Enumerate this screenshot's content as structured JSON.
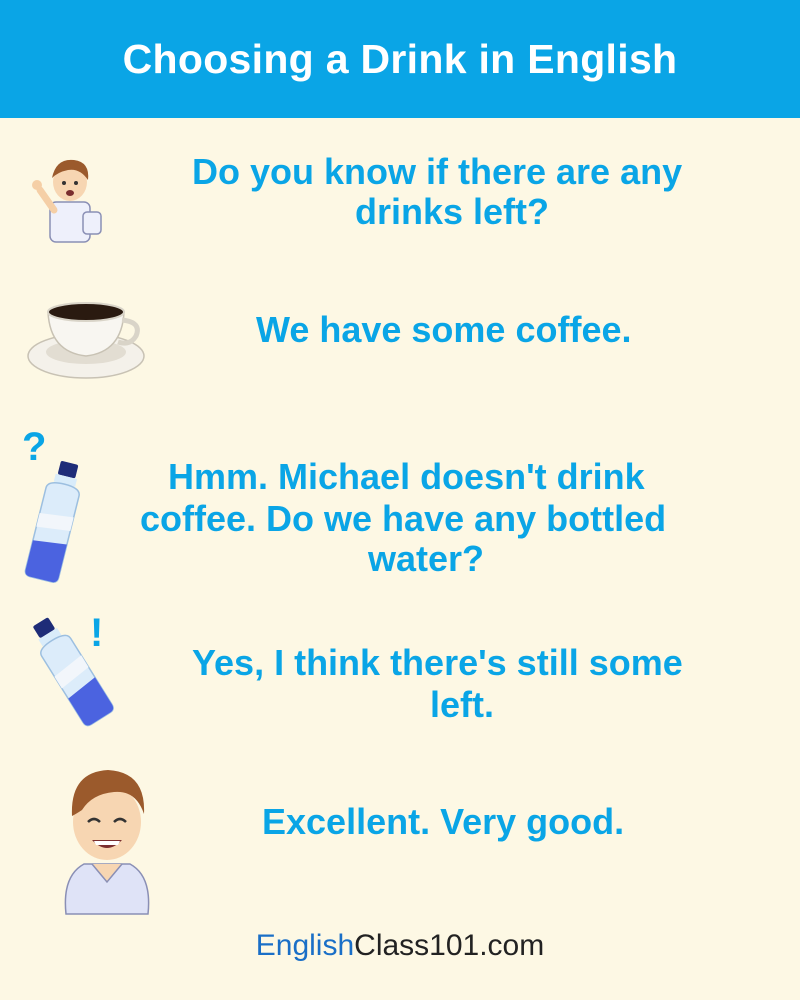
{
  "header": {
    "title": "Choosing a Drink in English"
  },
  "dialogue": [
    {
      "lines": [
        "Do you know if there are any",
        "drinks left?"
      ],
      "icon": "boy-pointing-icon"
    },
    {
      "lines": [
        "We have some coffee."
      ],
      "icon": "coffee-cup-icon"
    },
    {
      "lines": [
        "Hmm. Michael doesn't drink",
        "coffee. Do we have any bottled",
        "water?"
      ],
      "icon": "water-bottle-question-icon",
      "mark": "?"
    },
    {
      "lines": [
        "Yes, I think there's still some",
        "left."
      ],
      "icon": "water-bottle-exclaim-icon",
      "mark": "!"
    },
    {
      "lines": [
        "Excellent. Very good."
      ],
      "icon": "boy-smiling-icon"
    }
  ],
  "footer": {
    "part1": "English",
    "part2": "Class101.com"
  },
  "colors": {
    "header_bg": "#0aa5e6",
    "text_blue": "#0aa5e6",
    "page_bg": "#fdf8e4",
    "brand_blue": "#1a6fc7"
  }
}
